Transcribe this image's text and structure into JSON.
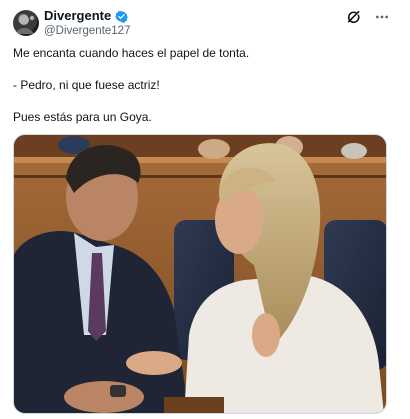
{
  "author": {
    "display_name": "Divergente",
    "handle": "@Divergente127",
    "verified": true,
    "badge_color": "#1d9bf0"
  },
  "icons": {
    "avatar": "avatar",
    "verified": "verified-badge-icon",
    "grok": "grok-icon",
    "more": "more-options-icon"
  },
  "tweet": {
    "lines": [
      "Me encanta cuando haces el papel de tonta.",
      "- Pedro, ni que fuese actriz!",
      "Pues estás para un Goya."
    ]
  },
  "media": {
    "type": "photo"
  }
}
